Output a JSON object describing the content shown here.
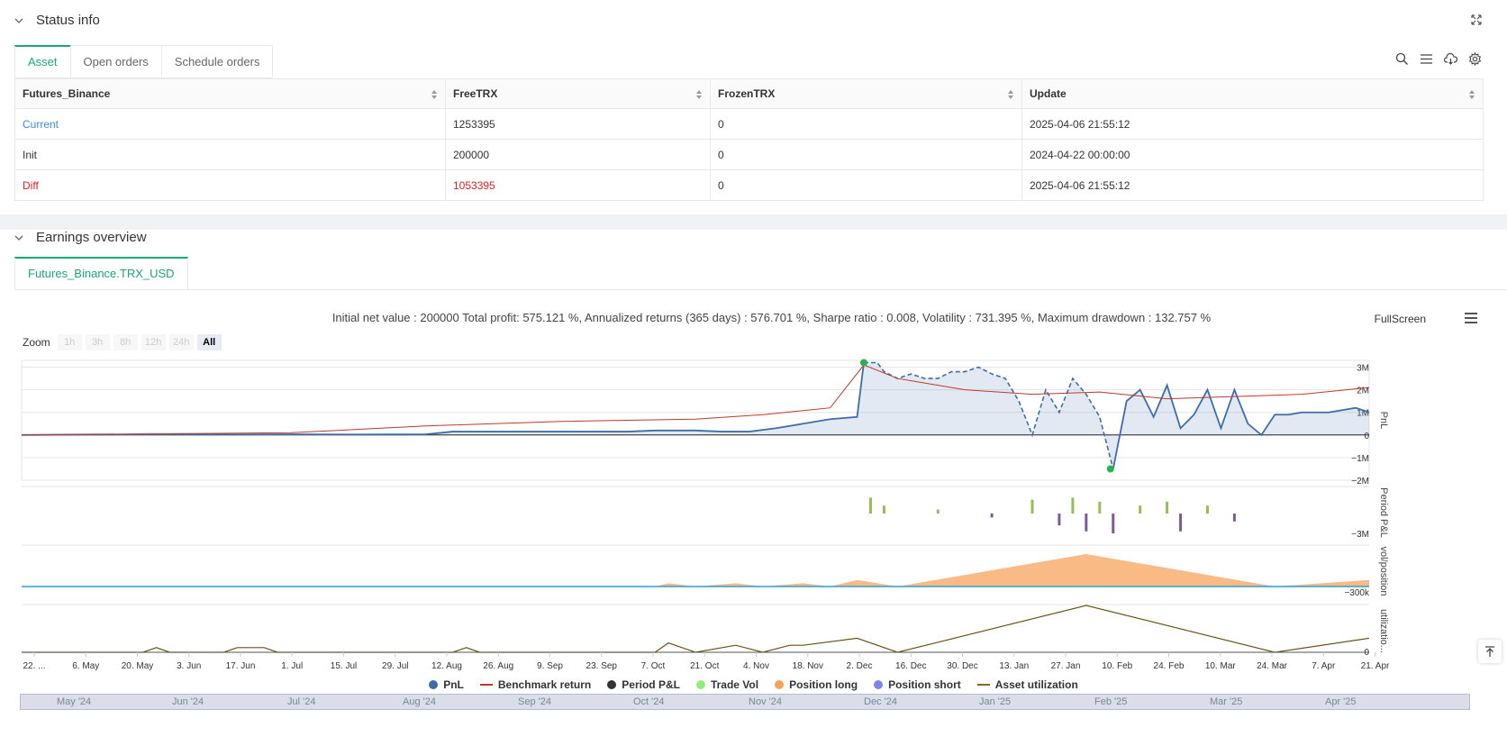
{
  "status": {
    "title": "Status info",
    "tabs": [
      "Asset",
      "Open orders",
      "Schedule orders"
    ],
    "table": {
      "headers": [
        "Futures_Binance",
        "FreeTRX",
        "FrozenTRX",
        "Update"
      ],
      "rows": [
        [
          "Current",
          "1253395",
          "0",
          "2025-04-06 21:55:12"
        ],
        [
          "Init",
          "200000",
          "0",
          "2024-04-22 00:00:00"
        ],
        [
          "Diff",
          "1053395",
          "0",
          "2025-04-06 21:55:12"
        ]
      ]
    }
  },
  "earnings": {
    "title": "Earnings overview",
    "tab": "Futures_Binance.TRX_USD",
    "summary": "Initial net value : 200000 Total profit: 575.121 %, Annualized returns (365 days) : 576.701 %, Sharpe ratio : 0.008, Volatility : 731.395 %, Maximum drawdown : 132.757 %",
    "fullscreen": "FullScreen",
    "zoom_label": "Zoom",
    "zoom_buttons": [
      "1h",
      "3h",
      "8h",
      "12h",
      "24h",
      "All"
    ],
    "legend": [
      "PnL",
      "Benchmark return",
      "Period P&L",
      "Trade Vol",
      "Position long",
      "Position short",
      "Asset utilization"
    ],
    "navigator_labels": [
      "May '24",
      "Jun '24",
      "Jul '24",
      "Aug '24",
      "Sep '24",
      "Oct '24",
      "Nov '24",
      "Dec '24",
      "Jan '25",
      "Feb '25",
      "Mar '25",
      "Apr '25"
    ]
  },
  "colors": {
    "accent": "#17a979",
    "pnl": "#3d6ea8",
    "benchmark": "#c0392b",
    "period": "#333333",
    "trade_vol": "#90ee7e",
    "position_long": "#f7a35c",
    "position_short": "#8085e9",
    "utilization": "#8b6914"
  },
  "chart_data": {
    "type": "line",
    "x_ticks": [
      "22. ...",
      "6. May",
      "20. May",
      "3. Jun",
      "17. Jun",
      "1. Jul",
      "15. Jul",
      "29. Jul",
      "12. Aug",
      "26. Aug",
      "9. Sep",
      "23. Sep",
      "7. Oct",
      "21. Oct",
      "4. Nov",
      "18. Nov",
      "2. Dec",
      "16. Dec",
      "30. Dec",
      "13. Jan",
      "27. Jan",
      "10. Feb",
      "24. Feb",
      "10. Mar",
      "24. Mar",
      "7. Apr",
      "21. Apr"
    ],
    "panes": [
      {
        "axis_label": "PnL",
        "ticks": [
          "3M",
          "2M",
          "1M",
          "0",
          "−1M",
          "−2M"
        ]
      },
      {
        "axis_label": "Period P&L",
        "ticks": [
          "−3M"
        ]
      },
      {
        "axis_label": "vol/position",
        "ticks": [
          "−300k"
        ]
      },
      {
        "axis_label": "utilizatio...",
        "ticks": [
          "0"
        ]
      }
    ],
    "pnl_series": [
      [
        0,
        0
      ],
      [
        5,
        0.02
      ],
      [
        10,
        0.03
      ],
      [
        15,
        0.02
      ],
      [
        20,
        0.03
      ],
      [
        25,
        0.02
      ],
      [
        30,
        0.03
      ],
      [
        32,
        0.15
      ],
      [
        40,
        0.15
      ],
      [
        45,
        0.15
      ],
      [
        47,
        0.2
      ],
      [
        50,
        0.2
      ],
      [
        52,
        0.15
      ],
      [
        54,
        0.15
      ],
      [
        56,
        0.3
      ],
      [
        58,
        0.5
      ],
      [
        60,
        0.7
      ],
      [
        62,
        0.8
      ],
      [
        62.5,
        3.2
      ],
      [
        63.5,
        3.2
      ],
      [
        64,
        2.8
      ],
      [
        65,
        2.5
      ],
      [
        66,
        2.7
      ],
      [
        67,
        2.5
      ],
      [
        68,
        2.5
      ],
      [
        69,
        2.8
      ],
      [
        70,
        2.8
      ],
      [
        71,
        3.0
      ],
      [
        72,
        2.7
      ],
      [
        73,
        2.5
      ],
      [
        74,
        1.5
      ],
      [
        75,
        0
      ],
      [
        76,
        2.0
      ],
      [
        77,
        1.0
      ],
      [
        78,
        2.5
      ],
      [
        79,
        1.8
      ],
      [
        80,
        0.8
      ],
      [
        81,
        -1.5
      ],
      [
        82,
        1.5
      ],
      [
        83,
        2.0
      ],
      [
        84,
        0.8
      ],
      [
        85,
        2.2
      ],
      [
        86,
        0.3
      ],
      [
        87,
        0.9
      ],
      [
        88,
        2.0
      ],
      [
        89,
        0.3
      ],
      [
        90,
        2.0
      ],
      [
        91,
        0.5
      ],
      [
        92,
        0
      ],
      [
        93,
        0.9
      ],
      [
        94,
        0.9
      ],
      [
        95,
        1.0
      ],
      [
        97,
        1.0
      ],
      [
        99,
        1.2
      ],
      [
        100,
        1.0
      ]
    ],
    "benchmark_series": [
      [
        0,
        0
      ],
      [
        10,
        0.05
      ],
      [
        20,
        0.1
      ],
      [
        30,
        0.4
      ],
      [
        40,
        0.6
      ],
      [
        50,
        0.7
      ],
      [
        55,
        0.9
      ],
      [
        60,
        1.2
      ],
      [
        62.5,
        3.1
      ],
      [
        65,
        2.5
      ],
      [
        70,
        2.0
      ],
      [
        75,
        1.8
      ],
      [
        80,
        1.9
      ],
      [
        85,
        1.6
      ],
      [
        90,
        1.7
      ],
      [
        95,
        1.8
      ],
      [
        100,
        2.1
      ]
    ],
    "period_bars": [
      [
        63,
        0.8
      ],
      [
        64,
        0.4
      ],
      [
        68,
        0.2
      ],
      [
        72,
        -0.2
      ],
      [
        75,
        0.7
      ],
      [
        77,
        -0.6
      ],
      [
        78,
        0.8
      ],
      [
        79,
        -0.9
      ],
      [
        80,
        0.6
      ],
      [
        81,
        -1.0
      ],
      [
        83,
        0.4
      ],
      [
        85,
        0.6
      ],
      [
        86,
        -0.9
      ],
      [
        88,
        0.4
      ],
      [
        90,
        -0.4
      ]
    ],
    "position_long_series": [
      [
        0,
        0
      ],
      [
        47,
        0
      ],
      [
        48,
        0.1
      ],
      [
        50,
        0
      ],
      [
        53,
        0.1
      ],
      [
        55,
        0
      ],
      [
        58,
        0.1
      ],
      [
        60,
        0
      ],
      [
        62,
        0.2
      ],
      [
        65,
        0
      ],
      [
        79,
        1.0
      ],
      [
        93,
        0
      ],
      [
        100,
        0.2
      ]
    ],
    "utilization_series": [
      [
        0,
        0
      ],
      [
        9,
        0
      ],
      [
        10,
        0.1
      ],
      [
        11,
        0
      ],
      [
        15,
        0
      ],
      [
        16,
        0.1
      ],
      [
        18,
        0.1
      ],
      [
        19,
        0
      ],
      [
        32,
        0
      ],
      [
        33,
        0.1
      ],
      [
        34,
        0
      ],
      [
        47,
        0
      ],
      [
        48,
        0.2
      ],
      [
        50,
        0
      ],
      [
        53,
        0.15
      ],
      [
        55,
        0
      ],
      [
        57,
        0.15
      ],
      [
        58,
        0.15
      ],
      [
        62,
        0.3
      ],
      [
        65,
        0
      ],
      [
        79,
        1.0
      ],
      [
        93,
        0
      ],
      [
        100,
        0.3
      ]
    ],
    "markers": [
      {
        "x": 62.5,
        "y": 3.2,
        "color": "#2db14f"
      },
      {
        "x": 80.8,
        "y": -1.5,
        "color": "#2db14f"
      }
    ]
  }
}
